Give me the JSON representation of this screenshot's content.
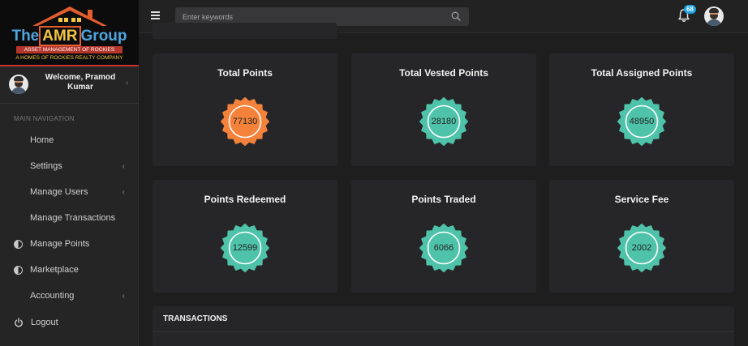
{
  "brand": {
    "name_prefix": "The",
    "name_mid": "AMR",
    "name_suffix": "Group",
    "tagline": "ASSET MANAGEMENT OF ROCKIES",
    "subtagline": "A HOMES OF ROCKIES REALTY COMPANY"
  },
  "user": {
    "welcome": "Welcome, Pramod Kumar"
  },
  "nav": {
    "header": "MAIN NAVIGATION",
    "items": [
      {
        "label": "Home",
        "icon": "dashboard-icon",
        "has_submenu": false
      },
      {
        "label": "Settings",
        "icon": "dashboard-icon",
        "has_submenu": true
      },
      {
        "label": "Manage Users",
        "icon": "dashboard-icon",
        "has_submenu": true
      },
      {
        "label": "Manage Transactions",
        "icon": "dashboard-icon",
        "has_submenu": false
      },
      {
        "label": "Manage Points",
        "icon": "half-circle-icon",
        "has_submenu": false
      },
      {
        "label": "Marketplace",
        "icon": "half-circle-icon",
        "has_submenu": false
      },
      {
        "label": "Accounting",
        "icon": "dashboard-icon",
        "has_submenu": true
      },
      {
        "label": "Logout",
        "icon": "power-icon",
        "has_submenu": false
      }
    ]
  },
  "topbar": {
    "search_placeholder": "Enter keywords",
    "notification_count": "68"
  },
  "stats": [
    {
      "title": "Total Points",
      "value": "77130",
      "color": "#f4823a"
    },
    {
      "title": "Total Vested Points",
      "value": "28180",
      "color": "#4fc3aa"
    },
    {
      "title": "Total Assigned Points",
      "value": "48950",
      "color": "#4fc3aa"
    },
    {
      "title": "Points Redeemed",
      "value": "12599",
      "color": "#4fc3aa"
    },
    {
      "title": "Points Traded",
      "value": "6066",
      "color": "#4fc3aa"
    },
    {
      "title": "Service Fee",
      "value": "2002",
      "color": "#4fc3aa"
    }
  ],
  "transactions": {
    "title": "TRANSACTIONS"
  }
}
